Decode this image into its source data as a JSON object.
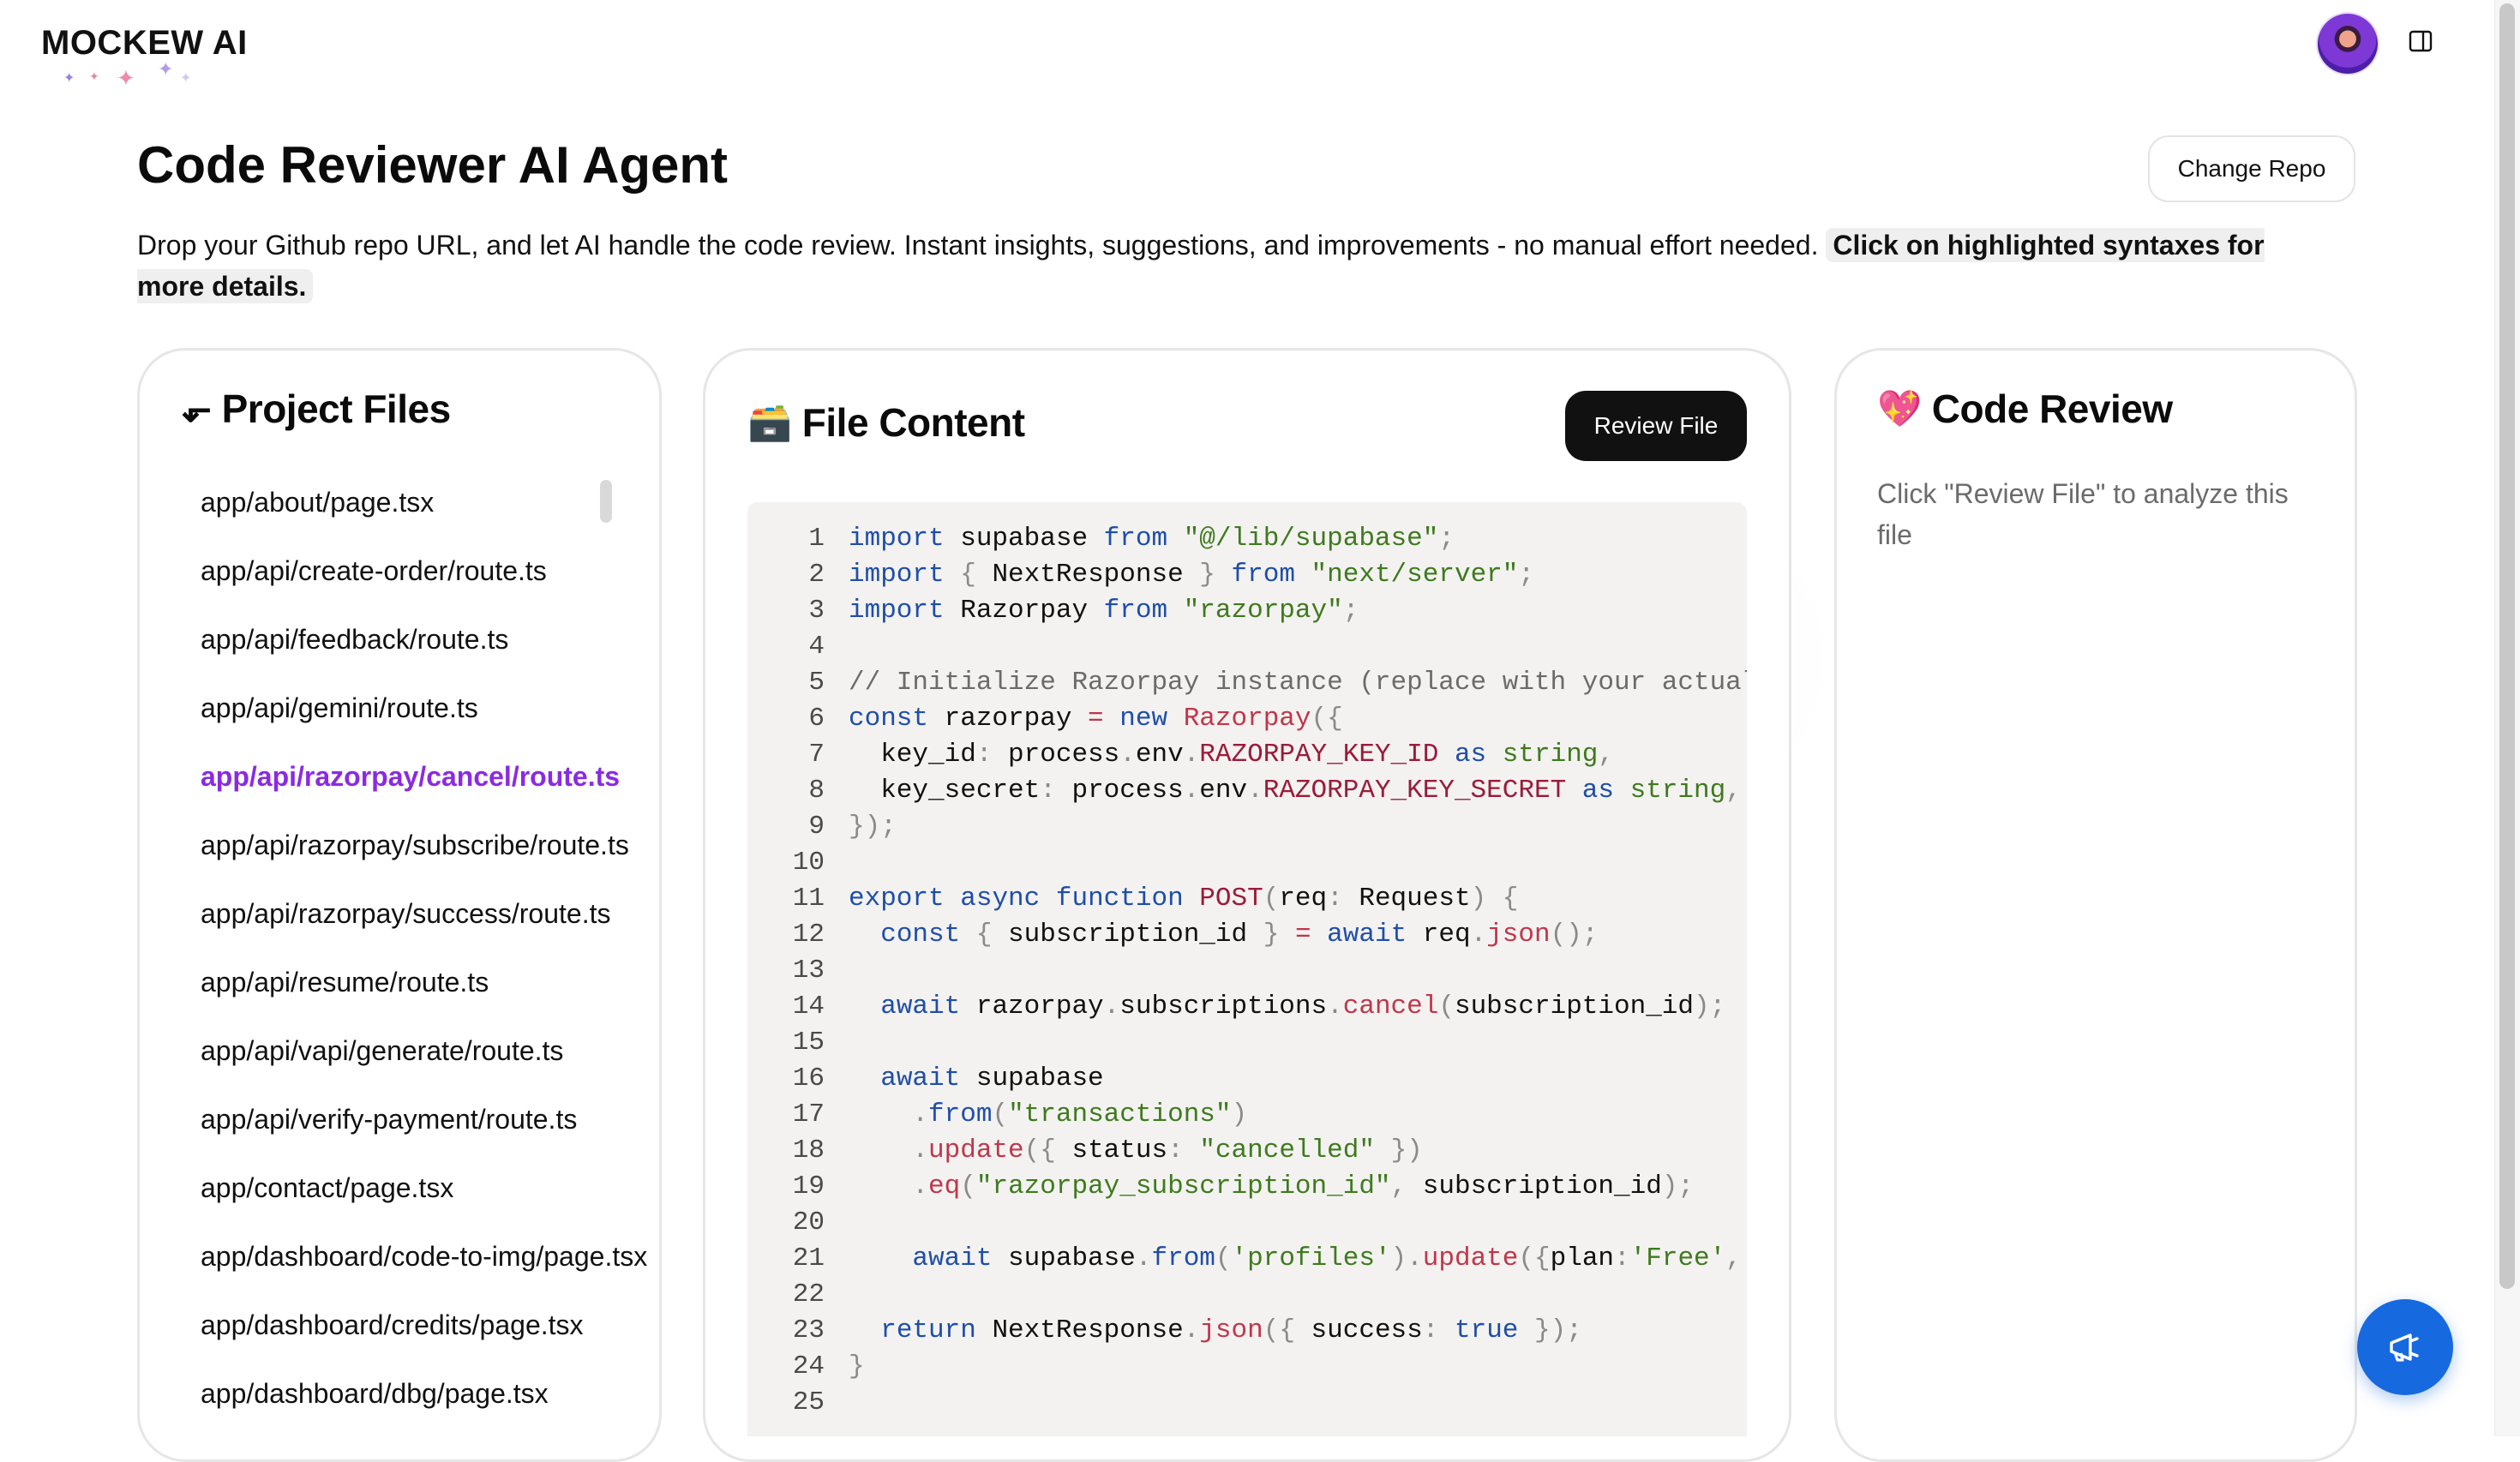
{
  "header": {
    "brand": "MOCKEW AI",
    "avatar_icon": "user-avatar",
    "layout_icon": "panel-layout-icon"
  },
  "page": {
    "title": "Code Reviewer AI Agent",
    "change_repo_label": "Change Repo",
    "description": "Drop your Github repo URL, and let AI handle the code review. Instant insights, suggestions, and improvements - no manual effort needed.",
    "description_highlight": "Click on highlighted syntaxes for more details."
  },
  "files_panel": {
    "icon": "⬐",
    "title": "Project Files",
    "files": [
      "app/about/page.tsx",
      "app/api/create-order/route.ts",
      "app/api/feedback/route.ts",
      "app/api/gemini/route.ts",
      "app/api/razorpay/cancel/route.ts",
      "app/api/razorpay/subscribe/route.ts",
      "app/api/razorpay/success/route.ts",
      "app/api/resume/route.ts",
      "app/api/vapi/generate/route.ts",
      "app/api/verify-payment/route.ts",
      "app/contact/page.tsx",
      "app/dashboard/code-to-img/page.tsx",
      "app/dashboard/credits/page.tsx",
      "app/dashboard/dbg/page.tsx"
    ],
    "active_index": 4
  },
  "content_panel": {
    "icon": "🗃️",
    "title": "File Content",
    "review_button_label": "Review File",
    "line_numbers": [
      "1",
      "2",
      "3",
      "4",
      "5",
      "6",
      "7",
      "8",
      "9",
      "10",
      "11",
      "12",
      "13",
      "14",
      "15",
      "16",
      "17",
      "18",
      "19",
      "20",
      "21",
      "22",
      "23",
      "24",
      "25"
    ]
  },
  "review_panel": {
    "icon": "💖",
    "title": "Code Review",
    "hint": "Click \"Review File\" to analyze this file"
  },
  "colors": {
    "accent": "#8a2be2",
    "fab": "#1769e0",
    "keyword": "#1f4ea8",
    "string": "#3f7a1d",
    "function": "#c0364a"
  },
  "fab": {
    "icon": "megaphone-icon"
  }
}
